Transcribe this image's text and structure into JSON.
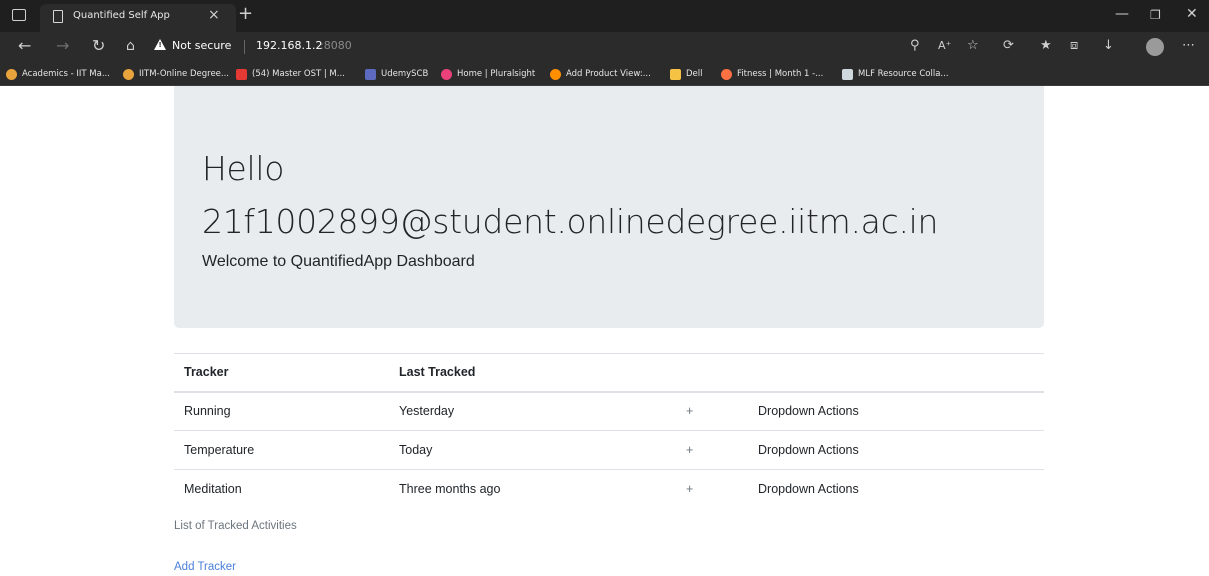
{
  "browser": {
    "tab_title": "Quantified Self App",
    "tab_close": "×",
    "new_tab": "+",
    "address": {
      "security_label": "Not secure",
      "host": "192.168.1.2",
      "port": ":8080"
    },
    "bookmarks": [
      {
        "label": "Academics - IIT Ma...",
        "color": "#e8a33c"
      },
      {
        "label": "IITM-Online Degree...",
        "color": "#e8a33c"
      },
      {
        "label": "(54) Master OST | M...",
        "color": "#e53935"
      },
      {
        "label": "UdemySCB",
        "color": "#5c6bc0"
      },
      {
        "label": "Home | Pluralsight",
        "color": "#ec407a"
      },
      {
        "label": "Add Product View:...",
        "color": "#ff8f00"
      },
      {
        "label": "Dell",
        "color": "#f6c344"
      },
      {
        "label": "Fitness | Month 1 -...",
        "color": "#ff7043"
      },
      {
        "label": "MLF Resource Colla...",
        "color": "#cfd8dc"
      }
    ]
  },
  "page": {
    "greeting": "Hello",
    "email": "21f1002899@student.onlinedegree.iitm.ac.in",
    "subtitle": "Welcome to QuantifiedApp Dashboard",
    "table": {
      "headers": [
        "Tracker",
        "Last Tracked",
        "",
        ""
      ],
      "rows": [
        {
          "tracker": "Running",
          "last": "Yesterday",
          "add": "+",
          "actions": "Dropdown Actions"
        },
        {
          "tracker": "Temperature",
          "last": "Today",
          "add": "+",
          "actions": "Dropdown Actions"
        },
        {
          "tracker": "Meditation",
          "last": "Three months ago",
          "add": "+",
          "actions": "Dropdown Actions"
        }
      ]
    },
    "caption": "List of Tracked Activities",
    "add_tracker": "Add Tracker"
  }
}
